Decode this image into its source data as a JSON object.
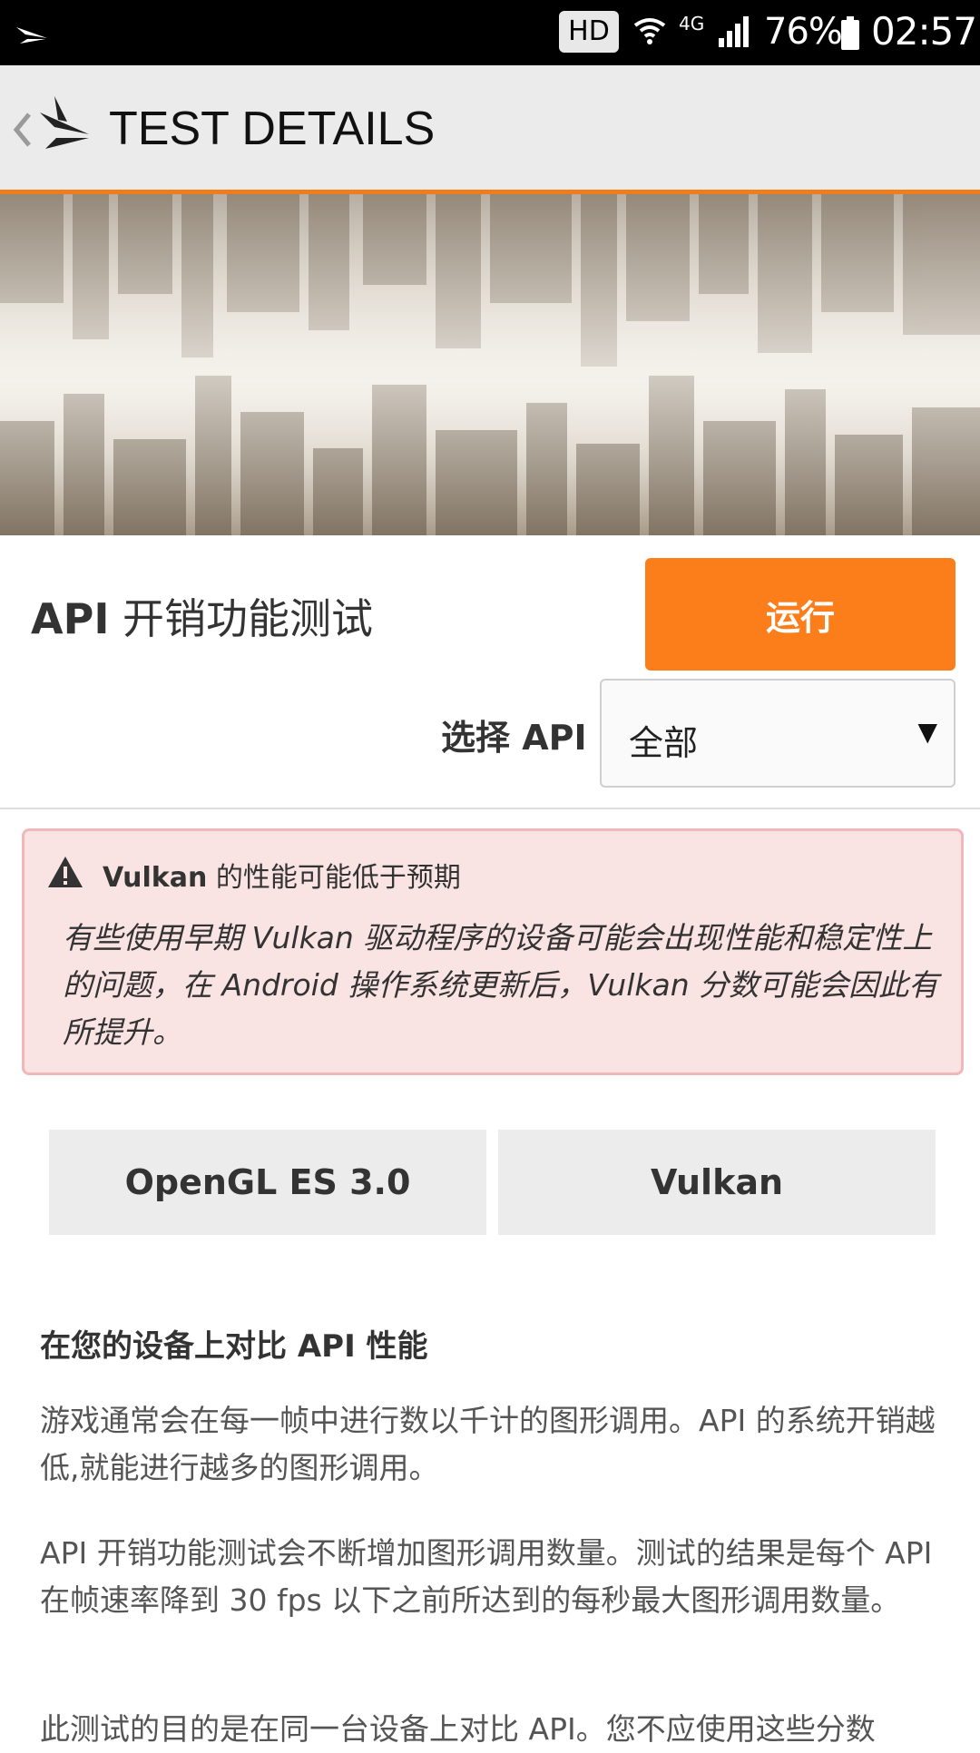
{
  "status_bar": {
    "hd_badge": "HD",
    "network": "4G",
    "battery": "76%",
    "time": "02:57"
  },
  "header": {
    "title": "TEST DETAILS"
  },
  "test": {
    "name_api": "API",
    "name_rest": " 开销功能测试",
    "run_label": "运行",
    "select_label": "选择 API",
    "select_value": "全部"
  },
  "warning": {
    "title_vulkan": "Vulkan",
    "title_rest": " 的性能可能低于预期",
    "body": "有些使用早期 Vulkan 驱动程序的设备可能会出现性能和稳定性上的问题，在 Android 操作系统更新后，Vulkan 分数可能会因此有所提升。"
  },
  "tabs": [
    {
      "label": "OpenGL ES 3.0"
    },
    {
      "label": "Vulkan"
    }
  ],
  "description": {
    "heading": "在您的设备上对比 API 性能",
    "p1": "游戏通常会在每一帧中进行数以千计的图形调用。API 的系统开销越低,就能进行越多的图形调用。",
    "p2": "API 开销功能测试会不断增加图形调用数量。测试的结果是每个 API 在帧速率降到 30 fps 以下之前所达到的每秒最大图形调用数量。",
    "p3": "此测试的目的是在同一台设备上对比 API。您不应使用这些分数"
  },
  "colors": {
    "accent": "#fb7e1b",
    "header_bg": "#ebebeb",
    "warning_bg": "#fae3e3",
    "warning_border": "#f2b7bb"
  }
}
